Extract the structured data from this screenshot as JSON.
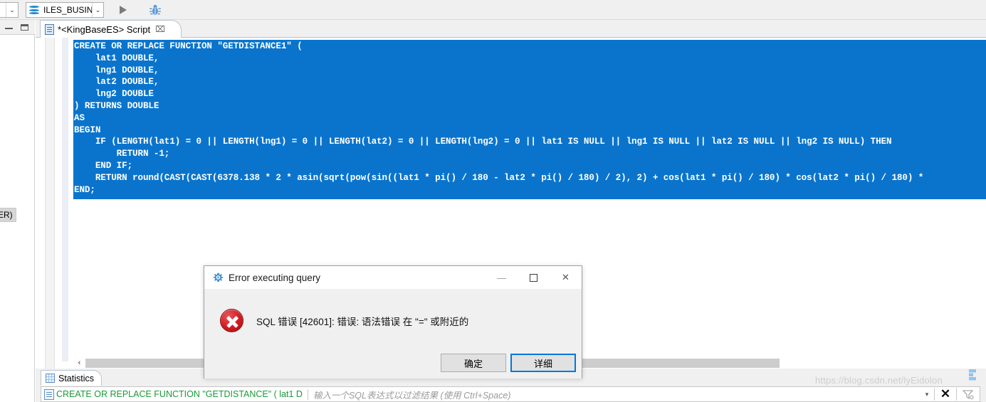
{
  "toolbar": {
    "catalog_combo_value": "",
    "schema_combo_value": "ILES_BUSIN",
    "db_icon": "database-icon",
    "execute_icon": "play-icon",
    "debug_icon": "bug-icon",
    "dropdown_glyph": "⌄"
  },
  "left_panel": {
    "minimize_icon": "minimize-icon",
    "maximize_icon": "maximize-icon",
    "edge_tooltip_text": "ER)"
  },
  "editor": {
    "tab_label": "*<KingBaseES> Script",
    "tab_close_glyph": "⌧",
    "file_icon": "script-file-icon",
    "code": "CREATE OR REPLACE FUNCTION \"GETDISTANCE1\" (\n    lat1 DOUBLE,\n    lng1 DOUBLE,\n    lat2 DOUBLE,\n    lng2 DOUBLE\n) RETURNS DOUBLE\nAS\nBEGIN\n    IF (LENGTH(lat1) = 0 || LENGTH(lng1) = 0 || LENGTH(lat2) = 0 || LENGTH(lng2) = 0 || lat1 IS NULL || lng1 IS NULL || lat2 IS NULL || lng2 IS NULL) THEN\n        RETURN -1;\n    END IF;\n    RETURN round(CAST(CAST(6378.138 * 2 * asin(sqrt(pow(sin((lat1 * pi() / 180 - lat2 * pi() / 180) / 2), 2) + cos(lat1 * pi() / 180) * cos(lat2 * pi() / 180) * \nEND;",
    "selection_color": "#0a74cd",
    "selection_text_color": "#ffffff",
    "scroll_left_glyph": "‹"
  },
  "bottom_panel": {
    "stats_tab_label": "Statistics",
    "stats_tab_icon": "grid-icon",
    "filter_query_icon": "sql-document-icon",
    "filter_query_text": "CREATE OR REPLACE FUNCTION \"GETDISTANCE\" ( lat1 D",
    "filter_placeholder": "输入一个SQL表达式以过滤结果  (使用 Ctrl+Space)",
    "filter_dropdown_glyph": "▾",
    "filter_clear_glyph": "✕",
    "filter_apply_icon": "filter-icon"
  },
  "dialog": {
    "title": "Error executing query",
    "title_icon": "gear-icon",
    "minimize_glyph": "—",
    "maximize_icon": "maximize-icon",
    "close_glyph": "✕",
    "error_icon": "error-circle-icon",
    "message": "SQL 错误 [42601]: 错误: 语法错误 在 \"=\" 或附近的",
    "ok_label": "确定",
    "details_label": "详细",
    "focus_color": "#0078d7"
  },
  "watermark": {
    "text": "https://blog.csdn.net/lyEidolon"
  }
}
